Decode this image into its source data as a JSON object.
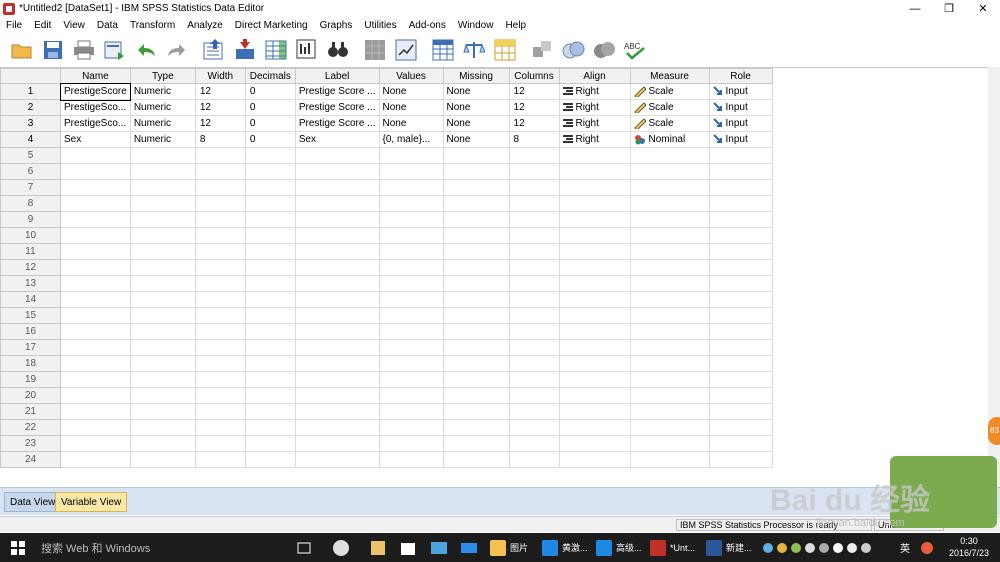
{
  "window": {
    "title": "*Untitled2 [DataSet1] - IBM SPSS Statistics Data Editor"
  },
  "menu": [
    "File",
    "Edit",
    "View",
    "Data",
    "Transform",
    "Analyze",
    "Direct Marketing",
    "Graphs",
    "Utilities",
    "Add-ons",
    "Window",
    "Help"
  ],
  "toolbar_icons": [
    "open-icon",
    "save-icon",
    "print-icon",
    "recall-dialog-icon",
    "undo-icon",
    "redo-icon",
    "goto-case-icon",
    "goto-variable-icon",
    "variables-icon",
    "run-descriptives-icon",
    "find-icon",
    "insert-cases-icon",
    "insert-variable-icon",
    "split-file-icon",
    "weight-cases-icon",
    "select-cases-icon",
    "value-labels-icon",
    "use-sets-icon",
    "show-all-icon",
    "spell-check-icon"
  ],
  "grid": {
    "headers": [
      "Name",
      "Type",
      "Width",
      "Decimals",
      "Label",
      "Values",
      "Missing",
      "Columns",
      "Align",
      "Measure",
      "Role"
    ],
    "rows": [
      {
        "num": "1",
        "name": "PrestigeScore",
        "type": "Numeric",
        "width": "12",
        "decimals": "0",
        "label": "Prestige Score ...",
        "values": "None",
        "missing": "None",
        "columns": "12",
        "align": "Right",
        "measure": "Scale",
        "role": "Input"
      },
      {
        "num": "2",
        "name": "PrestigeSco...",
        "type": "Numeric",
        "width": "12",
        "decimals": "0",
        "label": "Prestige Score ...",
        "values": "None",
        "missing": "None",
        "columns": "12",
        "align": "Right",
        "measure": "Scale",
        "role": "Input"
      },
      {
        "num": "3",
        "name": "PrestigeSco...",
        "type": "Numeric",
        "width": "12",
        "decimals": "0",
        "label": "Prestige Score ...",
        "values": "None",
        "missing": "None",
        "columns": "12",
        "align": "Right",
        "measure": "Scale",
        "role": "Input"
      },
      {
        "num": "4",
        "name": "Sex",
        "type": "Numeric",
        "width": "8",
        "decimals": "0",
        "label": "Sex",
        "values": "{0, male}...",
        "missing": "None",
        "columns": "8",
        "align": "Right",
        "measure": "Nominal",
        "role": "Input"
      }
    ],
    "empty_rows": [
      "5",
      "6",
      "7",
      "8",
      "9",
      "10",
      "11",
      "12",
      "13",
      "14",
      "15",
      "16",
      "17",
      "18",
      "19",
      "20",
      "21",
      "22",
      "23",
      "24"
    ]
  },
  "tabs": {
    "data_view": "Data View",
    "variable_view": "Variable View"
  },
  "status": {
    "processor": "IBM SPSS Statistics Processor is ready",
    "unicode": "Unicode:ON"
  },
  "taskbar": {
    "search_placeholder": "搜索 Web 和 Windows",
    "items": [
      {
        "label": "图片",
        "color": "#f2c14e"
      },
      {
        "label": "黄激...",
        "color": "#1e88e5"
      },
      {
        "label": "高级...",
        "color": "#1e88e5"
      },
      {
        "label": "*Unt...",
        "color": "#c0302a"
      },
      {
        "label": "新建...",
        "color": "#2b579a"
      }
    ],
    "ime": "英",
    "time": "0:30",
    "date": "2016/7/23"
  },
  "watermark": {
    "text": "Bai du 经验",
    "sub": "jingyan.baidu.com"
  },
  "colors": {
    "header_bg": "#f1f1f1",
    "tab_active": "#fbe7a8",
    "taskbar": "#1c1c1c"
  }
}
